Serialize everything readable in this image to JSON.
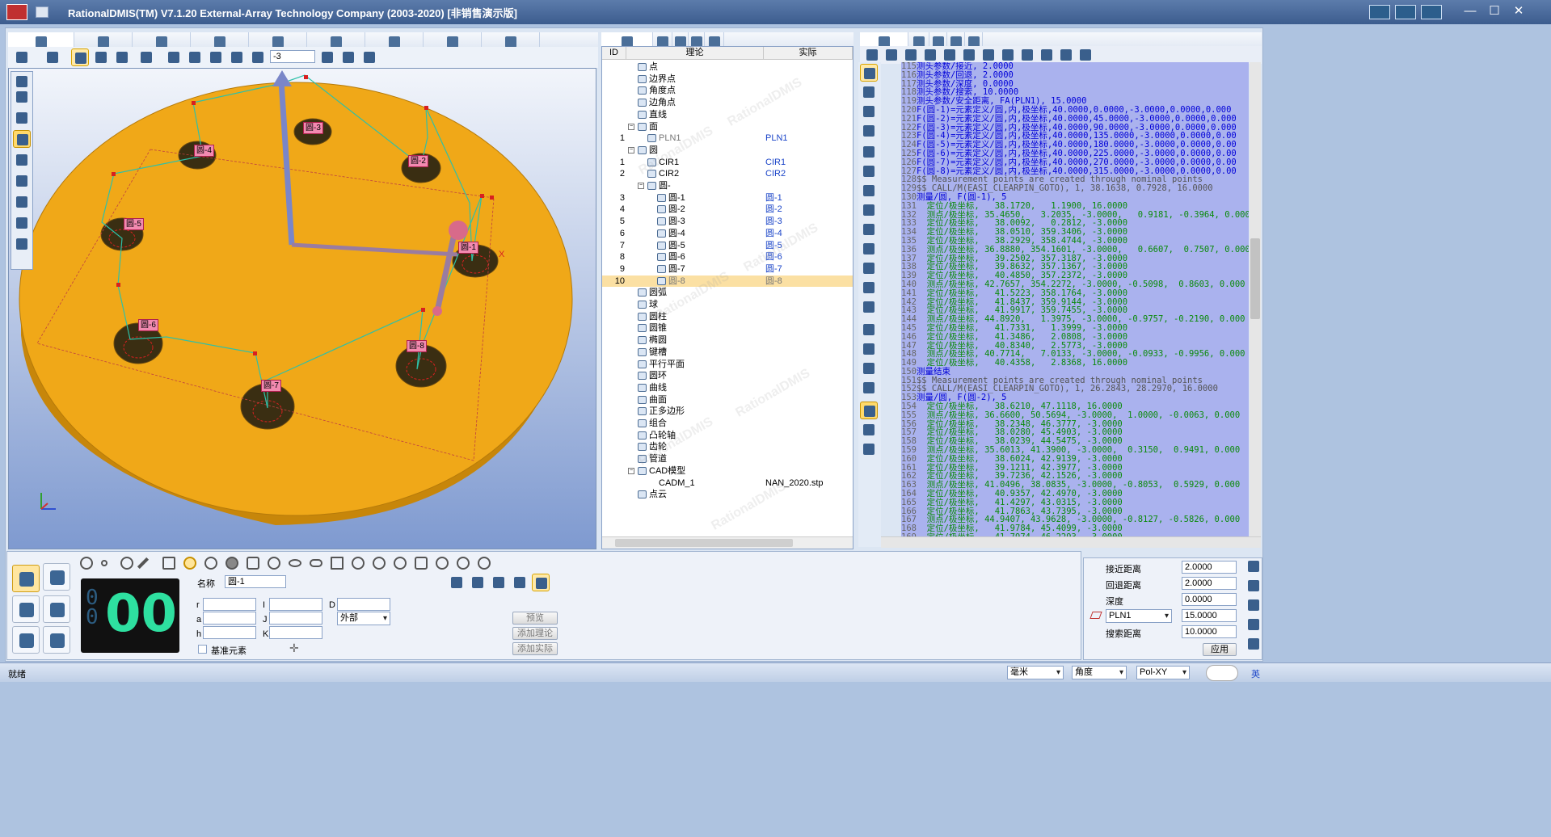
{
  "window": {
    "title": "RationalDMIS(TM) V7.1.20    External-Array Technology Company (2003-2020) [非销售演示版]",
    "controls": {
      "min": "—",
      "max": "☐",
      "close": "✕"
    }
  },
  "toolbar": {
    "view_value": "-3"
  },
  "viewport": {
    "labels": [
      "圆-3",
      "圆-4",
      "圆-2",
      "圆-5",
      "圆-1",
      "圆-6",
      "圆-8",
      "圆-7"
    ],
    "axis_x": "X"
  },
  "tree": {
    "headers": {
      "id": "ID",
      "nominal": "理论",
      "actual": "实际"
    },
    "rows": [
      {
        "id": "",
        "name": "点",
        "actual": "",
        "indent": 1,
        "exp": ""
      },
      {
        "id": "",
        "name": "边界点",
        "actual": "",
        "indent": 1,
        "exp": ""
      },
      {
        "id": "",
        "name": "角度点",
        "actual": "",
        "indent": 1,
        "exp": ""
      },
      {
        "id": "",
        "name": "边角点",
        "actual": "",
        "indent": 1,
        "exp": ""
      },
      {
        "id": "",
        "name": "直线",
        "actual": "",
        "indent": 1,
        "exp": ""
      },
      {
        "id": "",
        "name": "面",
        "actual": "",
        "indent": 1,
        "exp": "−"
      },
      {
        "id": "1",
        "name": "PLN1",
        "actual": "PLN1",
        "indent": 2,
        "exp": "",
        "muted": true
      },
      {
        "id": "",
        "name": "圆",
        "actual": "",
        "indent": 1,
        "exp": "−"
      },
      {
        "id": "1",
        "name": "CIR1",
        "actual": "CIR1",
        "indent": 2,
        "exp": ""
      },
      {
        "id": "2",
        "name": "CIR2",
        "actual": "CIR2",
        "indent": 2,
        "exp": ""
      },
      {
        "id": "",
        "name": "圆-",
        "actual": "",
        "indent": 2,
        "exp": "−"
      },
      {
        "id": "3",
        "name": "圆-1",
        "actual": "圆-1",
        "indent": 3,
        "exp": ""
      },
      {
        "id": "4",
        "name": "圆-2",
        "actual": "圆-2",
        "indent": 3,
        "exp": ""
      },
      {
        "id": "5",
        "name": "圆-3",
        "actual": "圆-3",
        "indent": 3,
        "exp": ""
      },
      {
        "id": "6",
        "name": "圆-4",
        "actual": "圆-4",
        "indent": 3,
        "exp": ""
      },
      {
        "id": "7",
        "name": "圆-5",
        "actual": "圆-5",
        "indent": 3,
        "exp": ""
      },
      {
        "id": "8",
        "name": "圆-6",
        "actual": "圆-6",
        "indent": 3,
        "exp": ""
      },
      {
        "id": "9",
        "name": "圆-7",
        "actual": "圆-7",
        "indent": 3,
        "exp": ""
      },
      {
        "id": "10",
        "name": "圆-8",
        "actual": "圆-8",
        "indent": 3,
        "exp": "",
        "selected": true
      },
      {
        "id": "",
        "name": "圆弧",
        "actual": "",
        "indent": 1,
        "exp": ""
      },
      {
        "id": "",
        "name": "球",
        "actual": "",
        "indent": 1,
        "exp": ""
      },
      {
        "id": "",
        "name": "圆柱",
        "actual": "",
        "indent": 1,
        "exp": ""
      },
      {
        "id": "",
        "name": "圆锥",
        "actual": "",
        "indent": 1,
        "exp": ""
      },
      {
        "id": "",
        "name": "椭圆",
        "actual": "",
        "indent": 1,
        "exp": ""
      },
      {
        "id": "",
        "name": "键槽",
        "actual": "",
        "indent": 1,
        "exp": ""
      },
      {
        "id": "",
        "name": "平行平面",
        "actual": "",
        "indent": 1,
        "exp": ""
      },
      {
        "id": "",
        "name": "圆环",
        "actual": "",
        "indent": 1,
        "exp": ""
      },
      {
        "id": "",
        "name": "曲线",
        "actual": "",
        "indent": 1,
        "exp": ""
      },
      {
        "id": "",
        "name": "曲面",
        "actual": "",
        "indent": 1,
        "exp": ""
      },
      {
        "id": "",
        "name": "正多边形",
        "actual": "",
        "indent": 1,
        "exp": ""
      },
      {
        "id": "",
        "name": "组合",
        "actual": "",
        "indent": 1,
        "exp": ""
      },
      {
        "id": "",
        "name": "凸轮轴",
        "actual": "",
        "indent": 1,
        "exp": ""
      },
      {
        "id": "",
        "name": "齿轮",
        "actual": "",
        "indent": 1,
        "exp": ""
      },
      {
        "id": "",
        "name": "管道",
        "actual": "",
        "indent": 1,
        "exp": ""
      },
      {
        "id": "",
        "name": "CAD模型",
        "actual": "",
        "indent": 1,
        "exp": "−"
      },
      {
        "id": "",
        "name": "CADM_1",
        "actual": "NAN_2020.stp",
        "indent": 2,
        "exp": "",
        "plain": true
      },
      {
        "id": "",
        "name": "点云",
        "actual": "",
        "indent": 1,
        "exp": ""
      }
    ],
    "watermark": "RationalDMIS"
  },
  "code": {
    "lines": [
      {
        "n": "115",
        "t": "测头参数/接近, 2.0000",
        "c": "blue"
      },
      {
        "n": "116",
        "t": "测头参数/回退, 2.0000",
        "c": "blue"
      },
      {
        "n": "117",
        "t": "测头参数/深度, 0.0000",
        "c": "blue"
      },
      {
        "n": "118",
        "t": "测头参数/搜索, 10.0000",
        "c": "blue"
      },
      {
        "n": "119",
        "t": "测头参数/安全距离, FA(PLN1), 15.0000",
        "c": "blue"
      },
      {
        "n": "120",
        "t": "F(圆-1)=元素定义/圆,内,极坐标,40.0000,0.0000,-3.0000,0.0000,0.000",
        "c": "blue"
      },
      {
        "n": "121",
        "t": "F(圆-2)=元素定义/圆,内,极坐标,40.0000,45.0000,-3.0000,0.0000,0.000",
        "c": "blue"
      },
      {
        "n": "122",
        "t": "F(圆-3)=元素定义/圆,内,极坐标,40.0000,90.0000,-3.0000,0.0000,0.000",
        "c": "blue"
      },
      {
        "n": "123",
        "t": "F(圆-4)=元素定义/圆,内,极坐标,40.0000,135.0000,-3.0000,0.0000,0.00",
        "c": "blue"
      },
      {
        "n": "124",
        "t": "F(圆-5)=元素定义/圆,内,极坐标,40.0000,180.0000,-3.0000,0.0000,0.00",
        "c": "blue"
      },
      {
        "n": "125",
        "t": "F(圆-6)=元素定义/圆,内,极坐标,40.0000,225.0000,-3.0000,0.0000,0.00",
        "c": "blue"
      },
      {
        "n": "126",
        "t": "F(圆-7)=元素定义/圆,内,极坐标,40.0000,270.0000,-3.0000,0.0000,0.00",
        "c": "blue"
      },
      {
        "n": "127",
        "t": "F(圆-8)=元素定义/圆,内,极坐标,40.0000,315.0000,-3.0000,0.0000,0.00",
        "c": "blue"
      },
      {
        "n": "128",
        "t": "$$ Measurement points are created through nominal points",
        "c": "comment"
      },
      {
        "n": "129",
        "t": "$$ CALL/M(EASI_CLEARPIN_GOTO), 1, 38.1638, 0.7928, 16.0000",
        "c": "comment"
      },
      {
        "n": "130",
        "t": "测量/圆, F(圆-1), 5",
        "c": "blue"
      },
      {
        "n": "131",
        "t": "  定位/极坐标,   38.1720,   1.1900, 16.0000",
        "c": "green"
      },
      {
        "n": "132",
        "t": "  测点/极坐标, 35.4650,   3.2035, -3.0000,   0.9181, -0.3964, 0.000",
        "c": "green"
      },
      {
        "n": "133",
        "t": "  定位/极坐标,   38.0092,   0.2812, -3.0000",
        "c": "green"
      },
      {
        "n": "134",
        "t": "  定位/极坐标,   38.0510, 359.3406, -3.0000",
        "c": "green"
      },
      {
        "n": "135",
        "t": "  定位/极坐标,   38.2929, 358.4744, -3.0000",
        "c": "green"
      },
      {
        "n": "136",
        "t": "  测点/极坐标, 36.8880, 354.1601, -3.0000,   0.6607,  0.7507, 0.000",
        "c": "green"
      },
      {
        "n": "137",
        "t": "  定位/极坐标,   39.2502, 357.3187, -3.0000",
        "c": "green"
      },
      {
        "n": "138",
        "t": "  定位/极坐标,   39.8632, 357.1367, -3.0000",
        "c": "green"
      },
      {
        "n": "139",
        "t": "  定位/极坐标,   40.4850, 357.2372, -3.0000",
        "c": "green"
      },
      {
        "n": "140",
        "t": "  测点/极坐标, 42.7657, 354.2272, -3.0000, -0.5098,  0.8603, 0.000",
        "c": "green"
      },
      {
        "n": "141",
        "t": "  定位/极坐标,   41.5223, 358.1764, -3.0000",
        "c": "green"
      },
      {
        "n": "142",
        "t": "  定位/极坐标,   41.8437, 359.9144, -3.0000",
        "c": "green"
      },
      {
        "n": "143",
        "t": "  定位/极坐标,   41.9917, 359.7455, -3.0000",
        "c": "green"
      },
      {
        "n": "144",
        "t": "  测点/极坐标, 44.8920,   1.3975, -3.0000, -0.9757, -0.2190, 0.000",
        "c": "green"
      },
      {
        "n": "145",
        "t": "  定位/极坐标,   41.7331,   1.3999, -3.0000",
        "c": "green"
      },
      {
        "n": "146",
        "t": "  定位/极坐标,   41.3486,   2.0808, -3.0000",
        "c": "green"
      },
      {
        "n": "147",
        "t": "  定位/极坐标,   40.8340,   2.5773, -3.0000",
        "c": "green"
      },
      {
        "n": "148",
        "t": "  测点/极坐标, 40.7714,   7.0133, -3.0000, -0.0933, -0.9956, 0.000",
        "c": "green"
      },
      {
        "n": "149",
        "t": "  定位/极坐标,   40.4358,   2.8368, 16.0000",
        "c": "green"
      },
      {
        "n": "150",
        "t": "测量结束",
        "c": "blue"
      },
      {
        "n": "151",
        "t": "$$ Measurement points are created through nominal points",
        "c": "comment"
      },
      {
        "n": "152",
        "t": "$$ CALL/M(EASI_CLEARPIN_GOTO), 1, 26.2843, 28.2970, 16.0000",
        "c": "comment"
      },
      {
        "n": "153",
        "t": "测量/圆, F(圆-2), 5",
        "c": "blue"
      },
      {
        "n": "154",
        "t": "  定位/极坐标,   38.6210, 47.1118, 16.0000",
        "c": "green"
      },
      {
        "n": "155",
        "t": "  测点/极坐标, 36.6600, 50.5694, -3.0000,  1.0000, -0.0063, 0.000",
        "c": "green"
      },
      {
        "n": "156",
        "t": "  定位/极坐标,   38.2348, 46.3777, -3.0000",
        "c": "green"
      },
      {
        "n": "157",
        "t": "  定位/极坐标,   38.0280, 45.4903, -3.0000",
        "c": "green"
      },
      {
        "n": "158",
        "t": "  定位/极坐标,   38.0239, 44.5475, -3.0000",
        "c": "green"
      },
      {
        "n": "159",
        "t": "  测点/极坐标, 35.6013, 41.3900, -3.0000,  0.3150,  0.9491, 0.000",
        "c": "green"
      },
      {
        "n": "160",
        "t": "  定位/极坐标,   38.6024, 42.9139, -3.0000",
        "c": "green"
      },
      {
        "n": "161",
        "t": "  定位/极坐标,   39.1211, 42.3977, -3.0000",
        "c": "green"
      },
      {
        "n": "162",
        "t": "  定位/极坐标,   39.7236, 42.1526, -3.0000",
        "c": "green"
      },
      {
        "n": "163",
        "t": "  测点/极坐标, 41.0496, 38.0835, -3.0000, -0.8053,  0.5929, 0.000",
        "c": "green"
      },
      {
        "n": "164",
        "t": "  定位/极坐标,   40.9357, 42.4970, -3.0000",
        "c": "green"
      },
      {
        "n": "165",
        "t": "  定位/极坐标,   41.4297, 43.0315, -3.0000",
        "c": "green"
      },
      {
        "n": "166",
        "t": "  定位/极坐标,   41.7863, 43.7395, -3.0000",
        "c": "green"
      },
      {
        "n": "167",
        "t": "  测点/极坐标, 44.9407, 43.9628, -3.0000, -0.8127, -0.5826, 0.000",
        "c": "green"
      },
      {
        "n": "168",
        "t": "  定位/极坐标,   41.9784, 45.4099, -3.0000",
        "c": "green"
      },
      {
        "n": "169",
        "t": "  定位/极坐标,   41.7974, 46.2293, -3.0000",
        "c": "green"
      }
    ]
  },
  "feature": {
    "counter": "00",
    "name_label": "名称",
    "name_value": "圆-1",
    "fields": {
      "r": "r",
      "a": "a",
      "h": "h",
      "i": "I",
      "j": "J",
      "k": "K",
      "d": "D"
    },
    "direction_value": "外部",
    "datum_label": "基准元素",
    "preview_btn": "预览",
    "add_nominal_btn": "添加理论",
    "add_actual_btn": "添加实际"
  },
  "params": {
    "approach_label": "接近距离",
    "approach": "2.0000",
    "retract_label": "回退距离",
    "retract": "2.0000",
    "depth_label": "深度",
    "depth": "0.0000",
    "clear_plane": "PLN1",
    "clear_value": "15.0000",
    "search_label": "搜索距离",
    "search": "10.0000",
    "apply_btn": "应用"
  },
  "status": {
    "text": "就绪",
    "unit": "毫米",
    "angle": "角度",
    "plane": "Pol-XY",
    "ime": "英"
  },
  "colors": {
    "part": "#f0a818",
    "part_side": "#c7860a",
    "background_top": "#f2f5fb",
    "background_bottom": "#7f9ad0",
    "code_bg": "#aab2ee"
  }
}
